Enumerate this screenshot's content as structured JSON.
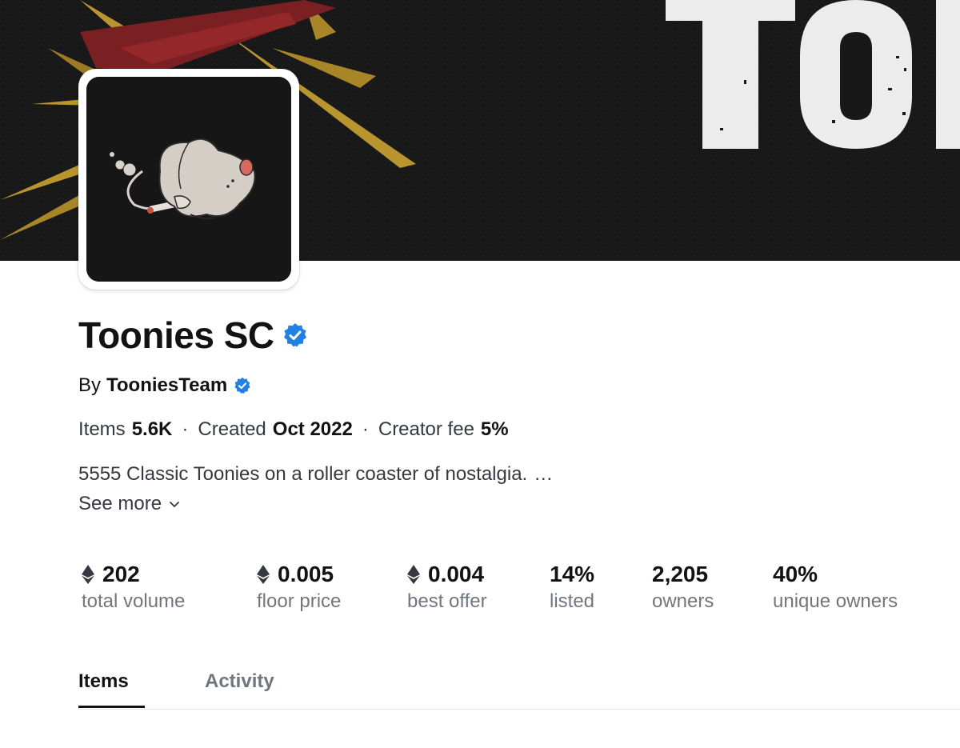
{
  "collection": {
    "name": "Toonies SC",
    "creator_prefix": "By",
    "creator": "TooniesTeam",
    "meta": {
      "items_label": "Items",
      "items_value": "5.6K",
      "created_label": "Created",
      "created_value": "Oct 2022",
      "fee_label": "Creator fee",
      "fee_value": "5%",
      "separator": "·"
    },
    "description": "5555 Classic Toonies on a roller coaster of nostalgia.",
    "description_ellipsis": "…",
    "see_more_label": "See more"
  },
  "stats": [
    {
      "value": "202",
      "label": "total volume",
      "eth": true
    },
    {
      "value": "0.005",
      "label": "floor price",
      "eth": true
    },
    {
      "value": "0.004",
      "label": "best offer",
      "eth": true
    },
    {
      "value": "14%",
      "label": "listed",
      "eth": false
    },
    {
      "value": "2,205",
      "label": "owners",
      "eth": false
    },
    {
      "value": "40%",
      "label": "unique owners",
      "eth": false
    }
  ],
  "tabs": [
    {
      "label": "Items",
      "active": true
    },
    {
      "label": "Activity",
      "active": false
    }
  ],
  "colors": {
    "verified_blue": "#2081e2",
    "text_primary": "#121212",
    "text_secondary": "#70757f"
  }
}
